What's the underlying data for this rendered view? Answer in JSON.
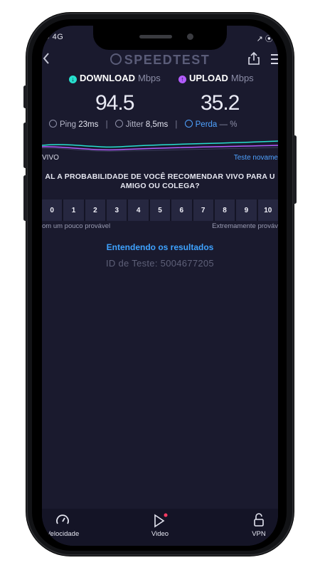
{
  "status_bar": {
    "left": "O 4G",
    "right": "↗ ⦿ 3"
  },
  "app": {
    "title": "SPEEDTEST"
  },
  "icons": {
    "back": "back-chevron-icon",
    "share": "share-icon",
    "menu": "menu-icon"
  },
  "download": {
    "label": "DOWNLOAD",
    "unit": "Mbps",
    "value": "94.5",
    "color": "#27e0cf"
  },
  "upload": {
    "label": "UPLOAD",
    "unit": "Mbps",
    "value": "35.2",
    "color": "#b35cff"
  },
  "metrics": {
    "ping_label": "Ping",
    "ping_value": "23ms",
    "jitter_label": "Jitter",
    "jitter_value": "8,5ms",
    "loss_label": "Perda",
    "loss_value": "— %"
  },
  "provider": {
    "name": "VIVO",
    "retest_label": "Teste novame"
  },
  "survey": {
    "question_line1": "AL A PROBABILIDADE DE VOCÊ RECOMENDAR VIVO PARA U",
    "question_line2": "AMIGO OU COLEGA?",
    "scale": [
      "0",
      "1",
      "2",
      "3",
      "4",
      "5",
      "6",
      "7",
      "8",
      "9",
      "10"
    ],
    "low_label": "om um pouco provável",
    "high_label": "Extremamente prováv"
  },
  "results": {
    "link": "Entendendo os resultados",
    "test_id": "ID de Teste: 5004677205"
  },
  "tabbar": {
    "speed": "Velocidade",
    "video": "Video",
    "vpn": "VPN"
  },
  "colors": {
    "background": "#1a1a2e",
    "accent_blue": "#3ea2ff",
    "video_dot": "#ff3b62"
  }
}
